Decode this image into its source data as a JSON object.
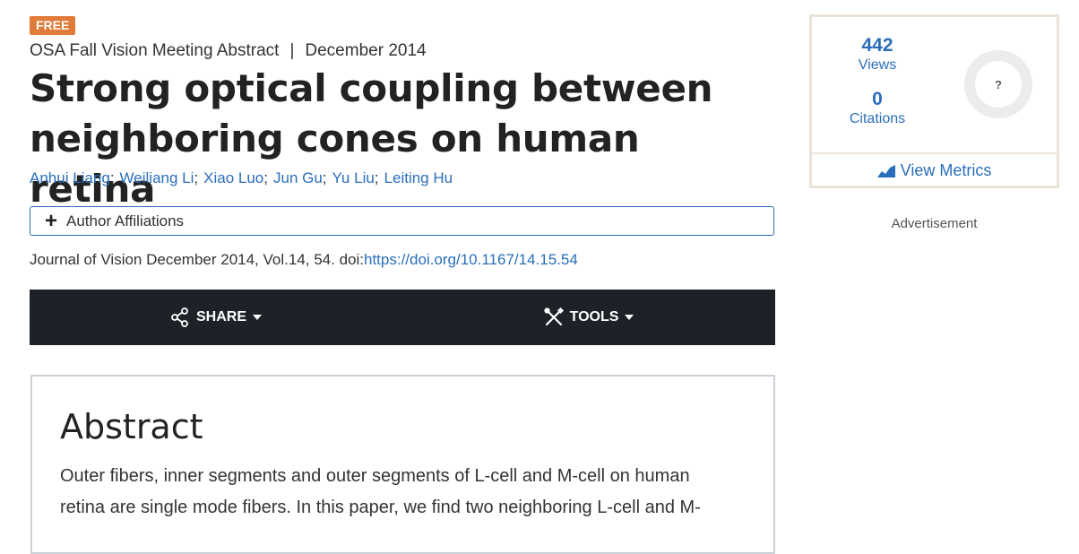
{
  "badge": "FREE",
  "meta": {
    "type": "OSA Fall Vision Meeting Abstract",
    "separator": "|",
    "date": "December 2014"
  },
  "title": "Strong optical coupling between neighboring cones on human retina",
  "authors": [
    "Anhui Liang",
    "Weiliang Li",
    "Xiao Luo",
    "Jun Gu",
    "Yu Liu",
    "Leiting Hu"
  ],
  "affiliations_label": "Author Affiliations",
  "citation": {
    "text": "Journal of Vision December 2014, Vol.14, 54. doi:",
    "doi": "https://doi.org/10.1167/14.15.54"
  },
  "toolbar": {
    "share_label": "SHARE",
    "tools_label": "TOOLS"
  },
  "abstract": {
    "heading": "Abstract",
    "line1": "Outer fibers, inner segments and outer segments of L-cell and M-cell on human",
    "line2": "retina are single mode fibers. In this paper, we find two neighboring L-cell and M-"
  },
  "metrics": {
    "views_count": "442",
    "views_label": "Views",
    "citations_count": "0",
    "citations_label": "Citations",
    "altmetric": "?",
    "view_metrics_label": "View Metrics"
  },
  "advertisement_label": "Advertisement",
  "colors": {
    "accent": "#2a6ebb",
    "badge": "#e07b39",
    "toolbar": "#1c2228"
  },
  "icons": {
    "share": "share-icon",
    "tools": "tools-icon",
    "caret": "caret-down-icon",
    "plus": "plus-icon",
    "chart": "chart-icon"
  }
}
